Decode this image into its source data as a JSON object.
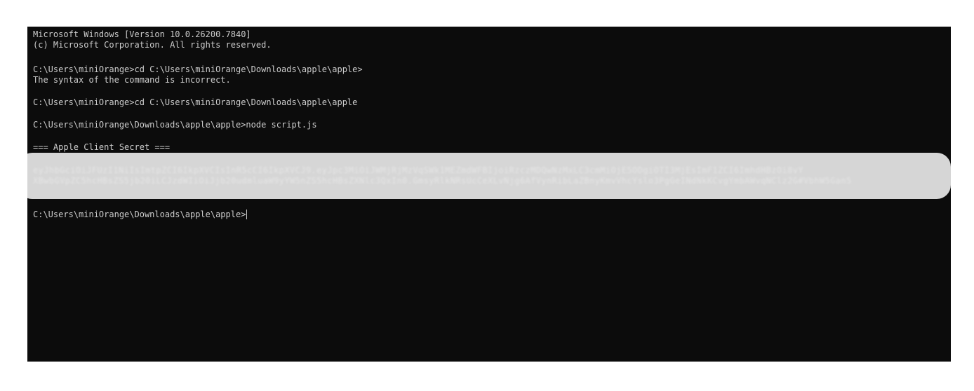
{
  "terminal": {
    "lines": {
      "l1": "Microsoft Windows [Version 10.0.26200.7840]",
      "l2": "(c) Microsoft Corporation. All rights reserved.",
      "l3": "C:\\Users\\miniOrange>cd C:\\Users\\miniOrange\\Downloads\\apple\\apple>",
      "l4": "The syntax of the command is incorrect.",
      "l5": "C:\\Users\\miniOrange>cd C:\\Users\\miniOrange\\Downloads\\apple\\apple",
      "l6": "C:\\Users\\miniOrange\\Downloads\\apple\\apple>node script.js",
      "l7": "=== Apple Client Secret ===",
      "prompt": "C:\\Users\\miniOrange\\Downloads\\apple\\apple>"
    },
    "secret": {
      "line1": "eyJhbGciOiJFUzI1NiIsImtpZCI6IkpXVCIsInR5cCI6IkpXVCJ9.eyJpc3MiOiJWMjRjMzVqSWk1MEZmdWFBIjoiRzczMDQwNzMxLC3cmMiOjE5ODgiOTI3MjEsImF1ZCI6ImhdHBzOi8vY",
      "line2": "XBwbGVpZC5hcHBsZS5jb20iLCJzdWIiOiJjb20udmluaW9yYW5nZS5hcHBsZXNlc3QxIn0.GmsyRlkNRsUcCeXLvNjg6AfVynRibLaZBnyKmvVhcYslo3PgGeINdNkKCvgYmbAWvqNClz2G#VbhW5Gan5"
    },
    "colors": {
      "background": "#0c0c0c",
      "text": "#cccccc",
      "redaction": "#d6d6d6"
    }
  }
}
